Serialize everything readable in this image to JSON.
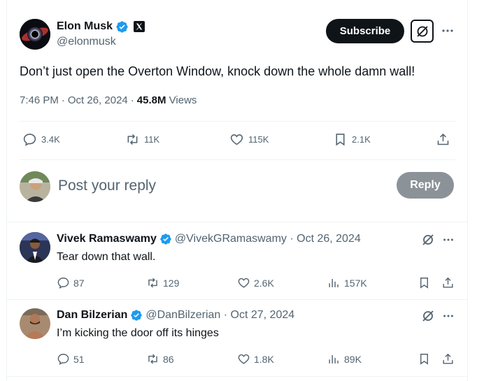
{
  "post": {
    "author_name": "Elon Musk",
    "author_handle": "@elonmusk",
    "subscribe_label": "Subscribe",
    "text": "Don’t just open the Overton Window, knock down the whole damn wall!",
    "time": "7:46 PM",
    "dot": "·",
    "date": "Oct 26, 2024",
    "views_count": "45.8M",
    "views_label": "Views",
    "stats": {
      "replies": "3.4K",
      "reposts": "11K",
      "likes": "115K",
      "bookmarks": "2.1K"
    }
  },
  "composer": {
    "placeholder": "Post your reply",
    "reply_label": "Reply"
  },
  "comments": [
    {
      "name": "Vivek Ramaswamy",
      "handle_date": "@VivekGRamaswamy · Oct 26, 2024",
      "text": "Tear down that wall.",
      "replies": "87",
      "reposts": "129",
      "likes": "2.6K",
      "views": "157K"
    },
    {
      "name": "Dan Bilzerian",
      "handle_date": "@DanBilzerian · Oct 27, 2024",
      "text": "I’m kicking the door off its hinges",
      "replies": "51",
      "reposts": "86",
      "likes": "1.8K",
      "views": "89K"
    }
  ],
  "colors": {
    "verified": "#1d9bf0",
    "text": "#0f1419",
    "muted": "#536471",
    "reply_button": "#8b9298"
  },
  "icons": [
    "verified-icon",
    "x-logo-icon",
    "grok-icon",
    "more-icon",
    "reply-icon",
    "repost-icon",
    "like-icon",
    "bookmark-icon",
    "share-icon",
    "views-icon"
  ]
}
